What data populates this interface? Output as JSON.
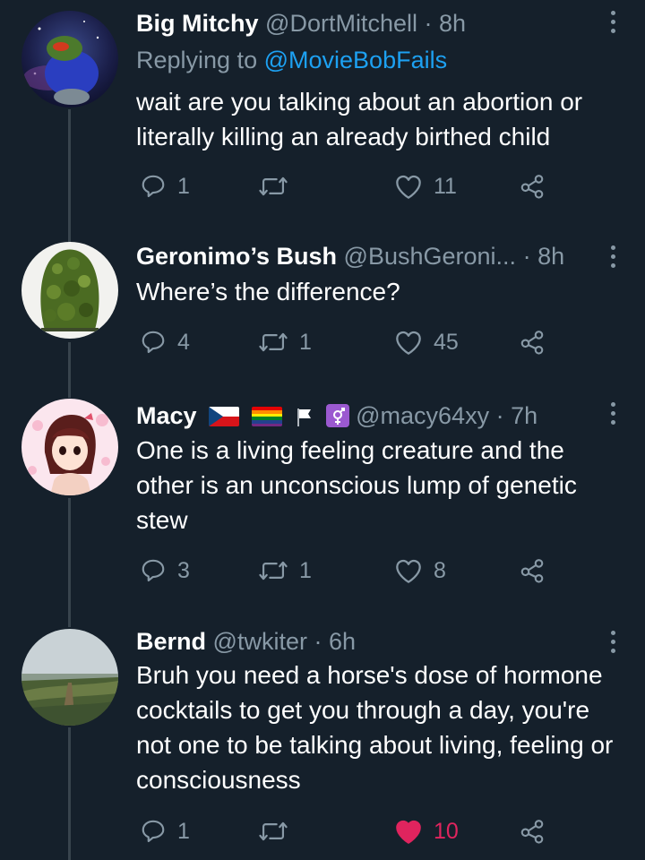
{
  "tweets": [
    {
      "name": "Big Mitchy",
      "handle": "@DortMitchell",
      "time": "8h",
      "replying_prefix": "Replying to",
      "replying_handle": "@MovieBobFails",
      "text": "wait are you talking about an abortion or literally killing an already birthed child",
      "replies": "1",
      "retweets": "",
      "likes": "11",
      "liked": false
    },
    {
      "name": "Geronimo’s Bush",
      "handle": "@BushGeroni...",
      "time": "8h",
      "text": "Where’s the difference?",
      "replies": "4",
      "retweets": "1",
      "likes": "45",
      "liked": false
    },
    {
      "name": "Macy",
      "name_emoji": [
        "czech-flag-emoji",
        "rainbow-flag-emoji",
        "white-flag-emoji",
        "transgender-symbol-emoji"
      ],
      "handle": "@macy64xy",
      "time": "7h",
      "text": "One is a living feeling creature and the other is an unconscious lump of genetic stew",
      "replies": "3",
      "retweets": "1",
      "likes": "8",
      "liked": false
    },
    {
      "name": "Bernd",
      "handle": "@twkiter",
      "time": "6h",
      "text": "Bruh you need a horse's dose of hormone cocktails to get you through a day, you're not one to be talking about living, feeling or consciousness",
      "replies": "1",
      "retweets": "",
      "likes": "10",
      "liked": true
    }
  ],
  "dot": "·",
  "colors": {
    "background": "#15202b",
    "secondary_text": "#8899a6",
    "link": "#1da1f2",
    "like_active": "#e0245e",
    "thread_line": "#38444d"
  },
  "icons": [
    "reply-icon",
    "retweet-icon",
    "like-icon",
    "share-icon",
    "more-icon"
  ]
}
